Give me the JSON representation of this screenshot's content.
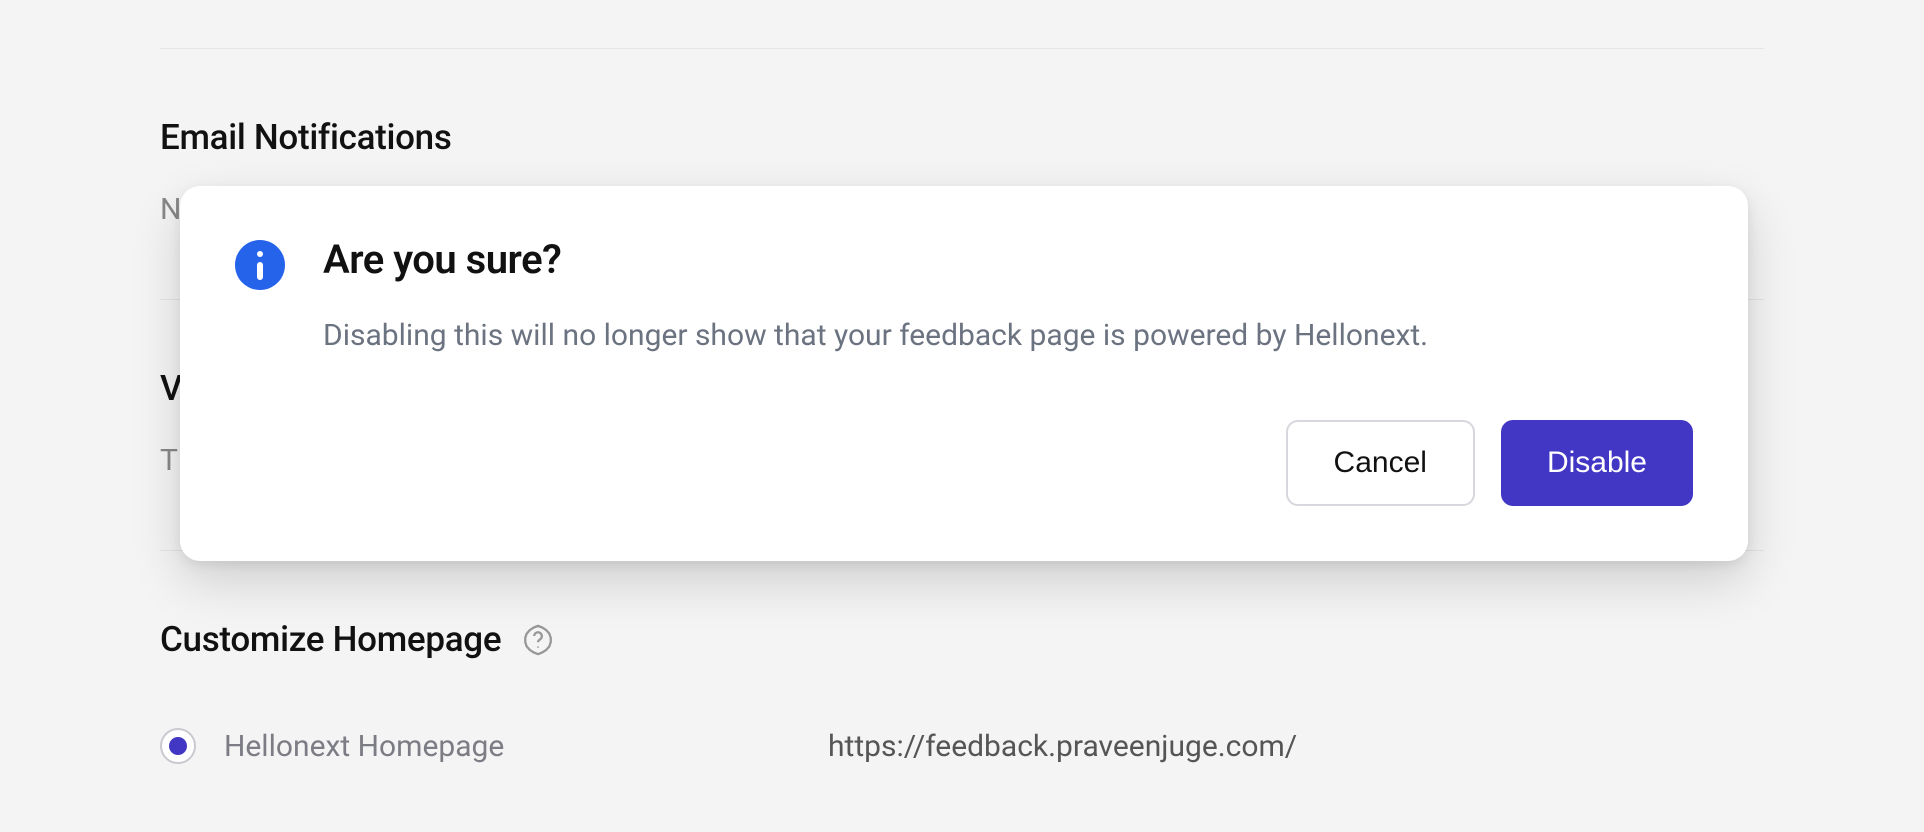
{
  "sections": {
    "email": {
      "title": "Email Notifications",
      "value": "N"
    },
    "hiddenV": {
      "title": "V",
      "value": "T"
    },
    "customize": {
      "title": "Customize Homepage"
    }
  },
  "homepage": {
    "option_label": "Hellonext Homepage",
    "url": "https://feedback.praveenjuge.com/"
  },
  "modal": {
    "title": "Are you sure?",
    "description": "Disabling this will no longer show that your feedback page is powered by Hellonext.",
    "cancel_label": "Cancel",
    "confirm_label": "Disable"
  }
}
